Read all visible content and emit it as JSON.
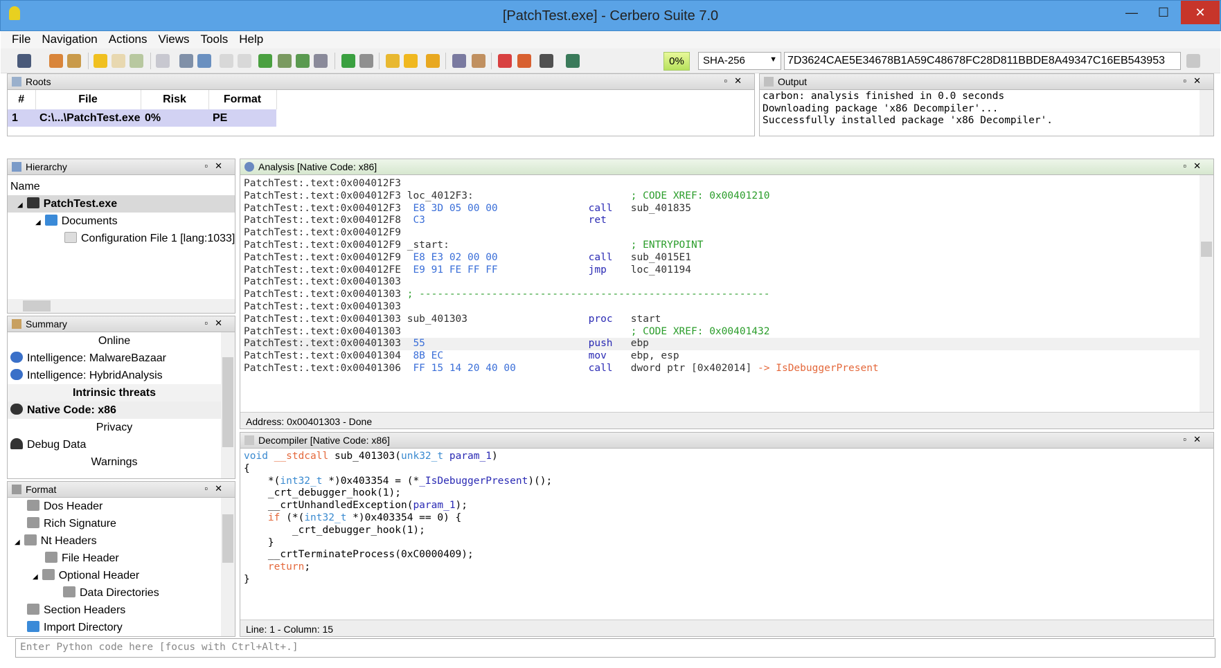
{
  "window": {
    "title": "[PatchTest.exe] - Cerbero Suite 7.0",
    "min": "—",
    "max": "☐",
    "close": "✕"
  },
  "menu": [
    "File",
    "Navigation",
    "Actions",
    "Views",
    "Tools",
    "Help"
  ],
  "toolbar": {
    "progress": "0%",
    "hash_algo": "SHA-256",
    "hash_value": "7D3624CAE5E34678B1A59C48678FC28D811BBDE8A49347C16EB543953"
  },
  "roots": {
    "title": "Roots",
    "columns": [
      "#",
      "File",
      "Risk",
      "Format"
    ],
    "row": [
      "1",
      "C:\\...\\PatchTest.exe",
      "0%",
      "PE"
    ]
  },
  "output": {
    "title": "Output",
    "lines": [
      "carbon: analysis finished in 0.0 seconds",
      "Downloading package 'x86 Decompiler'...",
      "Successfully installed package 'x86 Decompiler'."
    ]
  },
  "hierarchy": {
    "title": "Hierarchy",
    "header": "Name",
    "items": [
      "PatchTest.exe",
      "Documents",
      "Configuration File 1 [lang:1033]"
    ]
  },
  "summary": {
    "title": "Summary",
    "rows": [
      {
        "text": "Online",
        "kind": "section"
      },
      {
        "text": "Intelligence: MalwareBazaar",
        "kind": "item",
        "icon": "globe-icon"
      },
      {
        "text": "Intelligence: HybridAnalysis",
        "kind": "item",
        "icon": "globe-icon"
      },
      {
        "text": "Intrinsic threats",
        "kind": "section-bold"
      },
      {
        "text": "Native Code: x86",
        "kind": "item-bold",
        "icon": "radiation-icon"
      },
      {
        "text": "Privacy",
        "kind": "section"
      },
      {
        "text": "Debug Data",
        "kind": "item",
        "icon": "person-icon"
      },
      {
        "text": "Warnings",
        "kind": "section"
      }
    ]
  },
  "format": {
    "title": "Format",
    "items": [
      "Dos Header",
      "Rich Signature",
      "Nt Headers",
      "File Header",
      "Optional Header",
      "Data Directories",
      "Section Headers",
      "Import Directory"
    ]
  },
  "analysis": {
    "title": "Analysis [Native Code: x86]",
    "status": "Address: 0x00401303 - Done",
    "lines": [
      {
        "a": "PatchTest:.text:0x004012F3",
        "b": "",
        "m": "",
        "o": "",
        "c": ""
      },
      {
        "a": "PatchTest:.text:0x004012F3",
        "b": " loc_4012F3:",
        "m": "",
        "o": "",
        "c": "; CODE XREF: 0x00401210"
      },
      {
        "a": "PatchTest:.text:0x004012F3",
        "b": "",
        "h": "E8 3D 05 00 00",
        "m": "call",
        "o": "sub_401835",
        "c": ""
      },
      {
        "a": "PatchTest:.text:0x004012F8",
        "b": "",
        "h": "C3",
        "m": "ret",
        "o": "",
        "c": ""
      },
      {
        "a": "PatchTest:.text:0x004012F9",
        "b": "",
        "m": "",
        "o": "",
        "c": ""
      },
      {
        "a": "PatchTest:.text:0x004012F9",
        "b": " _start:",
        "m": "",
        "o": "",
        "c": "; ENTRYPOINT"
      },
      {
        "a": "PatchTest:.text:0x004012F9",
        "b": "",
        "h": "E8 E3 02 00 00",
        "m": "call",
        "o": "sub_4015E1",
        "c": ""
      },
      {
        "a": "PatchTest:.text:0x004012FE",
        "b": "",
        "h": "E9 91 FE FF FF",
        "m": "jmp",
        "o": "loc_401194",
        "c": ""
      },
      {
        "a": "PatchTest:.text:0x00401303",
        "b": "",
        "m": "",
        "o": "",
        "c": ""
      },
      {
        "a": "PatchTest:.text:0x00401303",
        "b": "",
        "m": "",
        "o": "",
        "c": "",
        "sep": " ; ----------------------------------------------------------"
      },
      {
        "a": "PatchTest:.text:0x00401303",
        "b": "",
        "m": "",
        "o": "",
        "c": ""
      },
      {
        "a": "PatchTest:.text:0x00401303",
        "b": " sub_401303",
        "m": "proc",
        "o": "start",
        "c": ""
      },
      {
        "a": "PatchTest:.text:0x00401303",
        "b": "",
        "m": "",
        "o": "",
        "c": "; CODE XREF: 0x00401432"
      },
      {
        "a": "PatchTest:.text:0x00401303",
        "b": "",
        "h": "55",
        "m": "push",
        "o": "ebp",
        "c": ""
      },
      {
        "a": "PatchTest:.text:0x00401304",
        "b": "",
        "h": "8B EC",
        "m": "mov",
        "o": "ebp, esp",
        "c": ""
      },
      {
        "a": "PatchTest:.text:0x00401306",
        "b": "",
        "h": "FF 15 14 20 40 00",
        "m": "call",
        "o": "dword ptr [0x402014]",
        "x": " -> IsDebuggerPresent",
        "c": ""
      }
    ]
  },
  "decompiler": {
    "title": "Decompiler [Native Code: x86]",
    "status": "Line: 1 - Column: 15",
    "lines": [
      "void __stdcall sub_401303(unk32_t param_1)",
      "{",
      "    *(int32_t *)0x403354 = (*_IsDebuggerPresent)();",
      "    _crt_debugger_hook(1);",
      "    __crtUnhandledException(param_1);",
      "    if (*(int32_t *)0x403354 == 0) {",
      "        _crt_debugger_hook(1);",
      "    }",
      "    __crtTerminateProcess(0xC0000409);",
      "    return;",
      "}"
    ]
  },
  "python": {
    "placeholder": "Enter Python code here [focus with Ctrl+Alt+.]"
  }
}
